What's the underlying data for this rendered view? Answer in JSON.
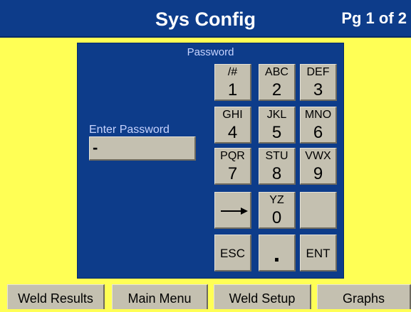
{
  "header": {
    "title": "Sys Config",
    "page_indicator": "Pg 1 of 2"
  },
  "panel": {
    "title": "Password",
    "password_label": "Enter Password",
    "password_value": "-"
  },
  "keypad": {
    "k1": {
      "letters": "/#",
      "digit": "1"
    },
    "k2": {
      "letters": "ABC",
      "digit": "2"
    },
    "k3": {
      "letters": "DEF",
      "digit": "3"
    },
    "k4": {
      "letters": "GHI",
      "digit": "4"
    },
    "k5": {
      "letters": "JKL",
      "digit": "5"
    },
    "k6": {
      "letters": "MNO",
      "digit": "6"
    },
    "k7": {
      "letters": "PQR",
      "digit": "7"
    },
    "k8": {
      "letters": "STU",
      "digit": "8"
    },
    "k9": {
      "letters": "VWX",
      "digit": "9"
    },
    "k0": {
      "letters": "YZ",
      "digit": "0"
    },
    "esc": "ESC",
    "dot": ".",
    "ent": "ENT",
    "arrow_icon": "right-arrow-icon"
  },
  "tabs": {
    "weld_results": "Weld Results",
    "main_menu": "Main Menu",
    "weld_setup": "Weld Setup",
    "graphs": "Graphs"
  },
  "colors": {
    "background": "#ffff55",
    "header": "#0d3c8a",
    "panel": "#0d3c8a",
    "key": "#c4c0b0",
    "panel_text": "#c8d4ff"
  }
}
